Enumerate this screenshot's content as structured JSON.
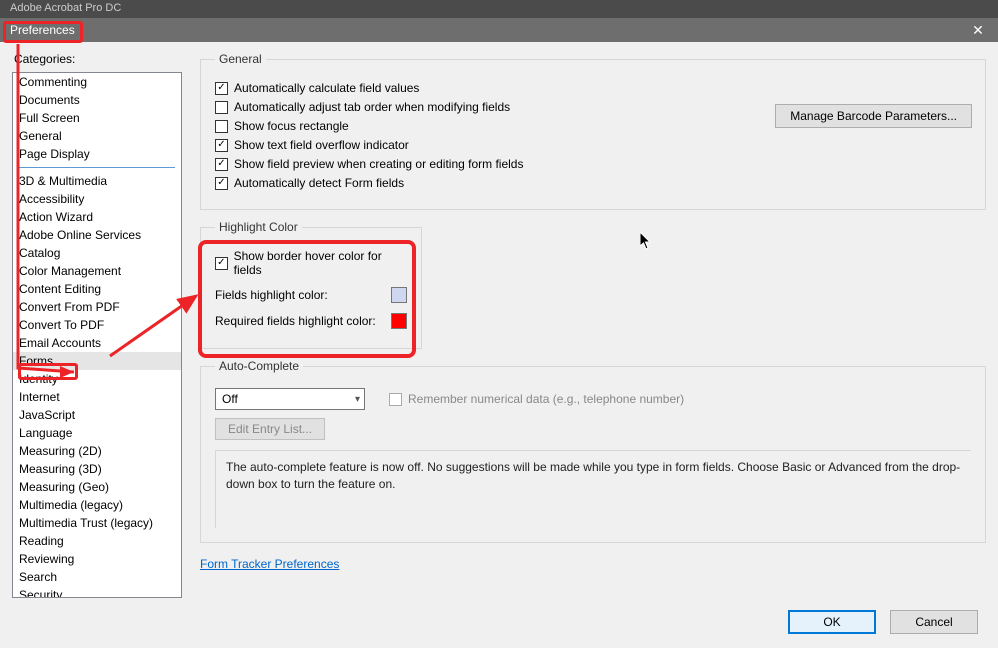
{
  "app": {
    "title": "Adobe Acrobat Pro DC"
  },
  "dialog": {
    "title": "Preferences"
  },
  "categories_label": "Categories:",
  "categories_top": [
    "Commenting",
    "Documents",
    "Full Screen",
    "General",
    "Page Display"
  ],
  "categories_rest": [
    "3D & Multimedia",
    "Accessibility",
    "Action Wizard",
    "Adobe Online Services",
    "Catalog",
    "Color Management",
    "Content Editing",
    "Convert From PDF",
    "Convert To PDF",
    "Email Accounts",
    "Forms",
    "Identity",
    "Internet",
    "JavaScript",
    "Language",
    "Measuring (2D)",
    "Measuring (3D)",
    "Measuring (Geo)",
    "Multimedia (legacy)",
    "Multimedia Trust (legacy)",
    "Reading",
    "Reviewing",
    "Search",
    "Security"
  ],
  "selected_category": "Forms",
  "general": {
    "legend": "General",
    "auto_calc": "Automatically calculate field values",
    "auto_tab": "Automatically adjust tab order when modifying fields",
    "focus_rect": "Show focus rectangle",
    "overflow": "Show text field overflow indicator",
    "preview": "Show field preview when creating or editing form fields",
    "detect": "Automatically detect Form fields",
    "manage_btn": "Manage Barcode Parameters..."
  },
  "highlight": {
    "legend": "Highlight Color",
    "show_border": "Show border hover color for fields",
    "fields_label": "Fields highlight color:",
    "fields_color": "#cfd6ef",
    "required_label": "Required fields highlight color:",
    "required_color": "#ff0000"
  },
  "auto": {
    "legend": "Auto-Complete",
    "selected": "Off",
    "remember": "Remember numerical data (e.g., telephone number)",
    "edit_btn": "Edit Entry List...",
    "desc": "The auto-complete feature is now off. No suggestions will be made while you type in form fields. Choose Basic or Advanced from the drop-down box to turn the feature on."
  },
  "tracker_link": "Form Tracker Preferences",
  "footer": {
    "ok": "OK",
    "cancel": "Cancel"
  }
}
